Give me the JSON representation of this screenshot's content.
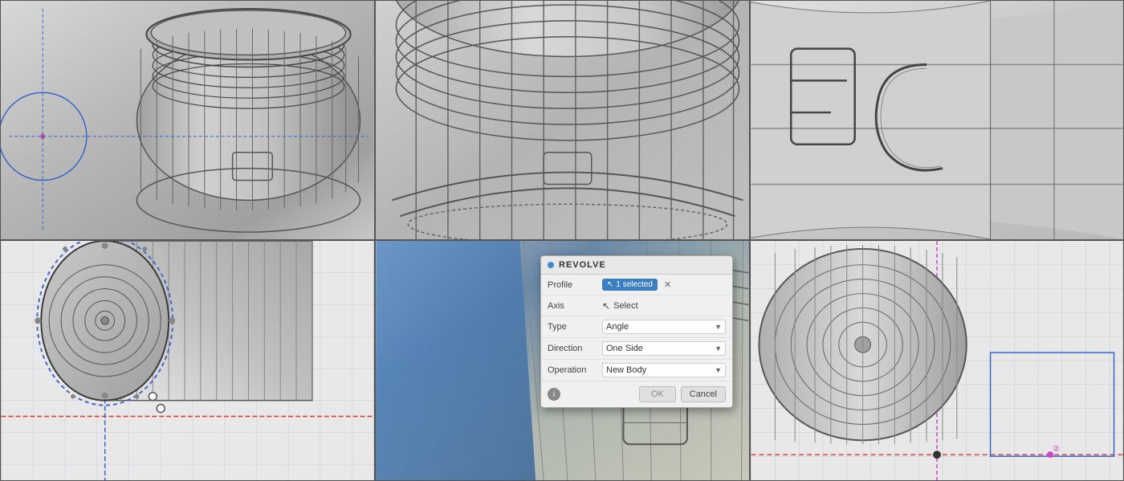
{
  "dialog": {
    "title": "REVOLVE",
    "profile_label": "Profile",
    "profile_value": "1 selected",
    "axis_label": "Axis",
    "axis_value": "Select",
    "type_label": "Type",
    "type_value": "Angle",
    "direction_label": "Direction",
    "direction_value": "One Side",
    "operation_label": "Operation",
    "operation_value": "New Body",
    "ok_label": "OK",
    "cancel_label": "Cancel"
  },
  "cells": [
    {
      "id": "cell-1",
      "position": "top-left"
    },
    {
      "id": "cell-2",
      "position": "top-center"
    },
    {
      "id": "cell-3",
      "position": "top-right"
    },
    {
      "id": "cell-4",
      "position": "bottom-left"
    },
    {
      "id": "cell-5",
      "position": "bottom-center"
    },
    {
      "id": "cell-6",
      "position": "bottom-right"
    }
  ],
  "colors": {
    "background": "#888888",
    "model_base": "#b8b8b8",
    "wire_dark": "#444444",
    "wire_mid": "#666666",
    "blue_accent": "#4a7ab5",
    "grid_line": "#b4b4cc",
    "dialog_bg": "#f0f0f0",
    "dialog_title_bg": "#e8e8e8",
    "badge_blue": "#3a7fc1",
    "btn_ok_bg": "#e0e0e0",
    "btn_cancel_bg": "#e0e0e0"
  }
}
